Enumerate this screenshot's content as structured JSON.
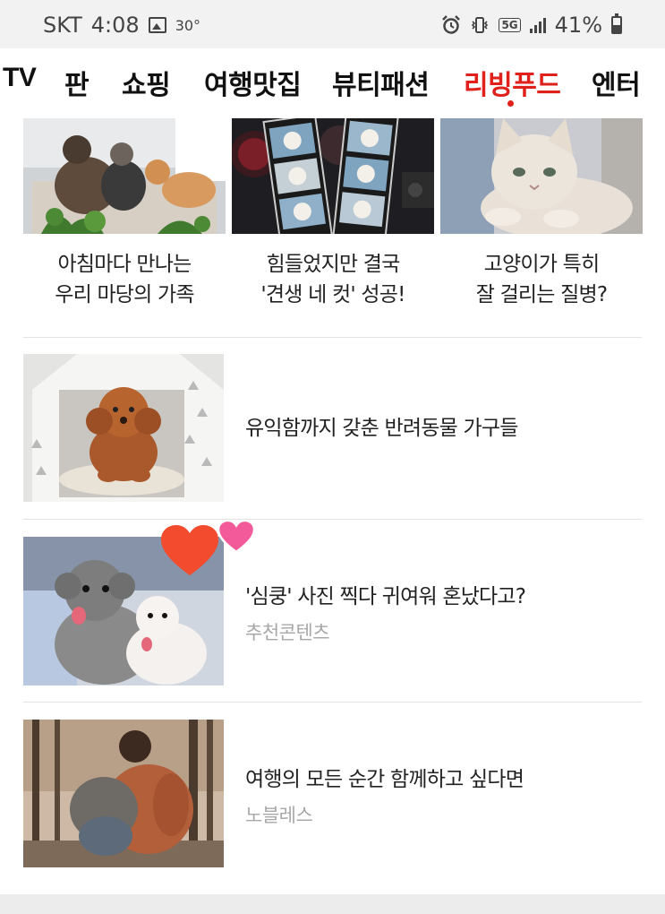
{
  "status_bar": {
    "carrier": "SKT",
    "time": "4:08",
    "temperature": "30°",
    "network": "5G",
    "battery": "41%"
  },
  "tabs": [
    {
      "label": "TV",
      "active": false
    },
    {
      "label": "판",
      "active": false
    },
    {
      "label": "쇼핑",
      "active": false
    },
    {
      "label": "여행맛집",
      "active": false
    },
    {
      "label": "뷰티패션",
      "active": false
    },
    {
      "label": "리빙푸드",
      "active": true
    },
    {
      "label": "엔터",
      "active": false
    }
  ],
  "accent_color": "#e0211b",
  "grid_cards": [
    {
      "line1": "아침마다 만나는",
      "line2": "우리 마당의 가족",
      "image": "cats-in-garden"
    },
    {
      "line1": "힘들었지만 결국",
      "line2": "'견생 네 컷' 성공!",
      "image": "dog-photo-strips"
    },
    {
      "line1": "고양이가 특히",
      "line2": "잘 걸리는 질병?",
      "image": "white-cat"
    }
  ],
  "list_items": [
    {
      "title": "유익함까지 갖춘 반려동물 가구들",
      "subtitle": "",
      "image": "poodle-in-pet-house"
    },
    {
      "title": "'심쿵' 사진 찍다 귀여워 혼났다고?",
      "subtitle": "추천콘텐츠",
      "image": "two-dogs-with-hearts"
    },
    {
      "title": "여행의 모든 순간 함께하고 싶다면",
      "subtitle": "노블레스",
      "image": "person-hugging-dog"
    }
  ]
}
